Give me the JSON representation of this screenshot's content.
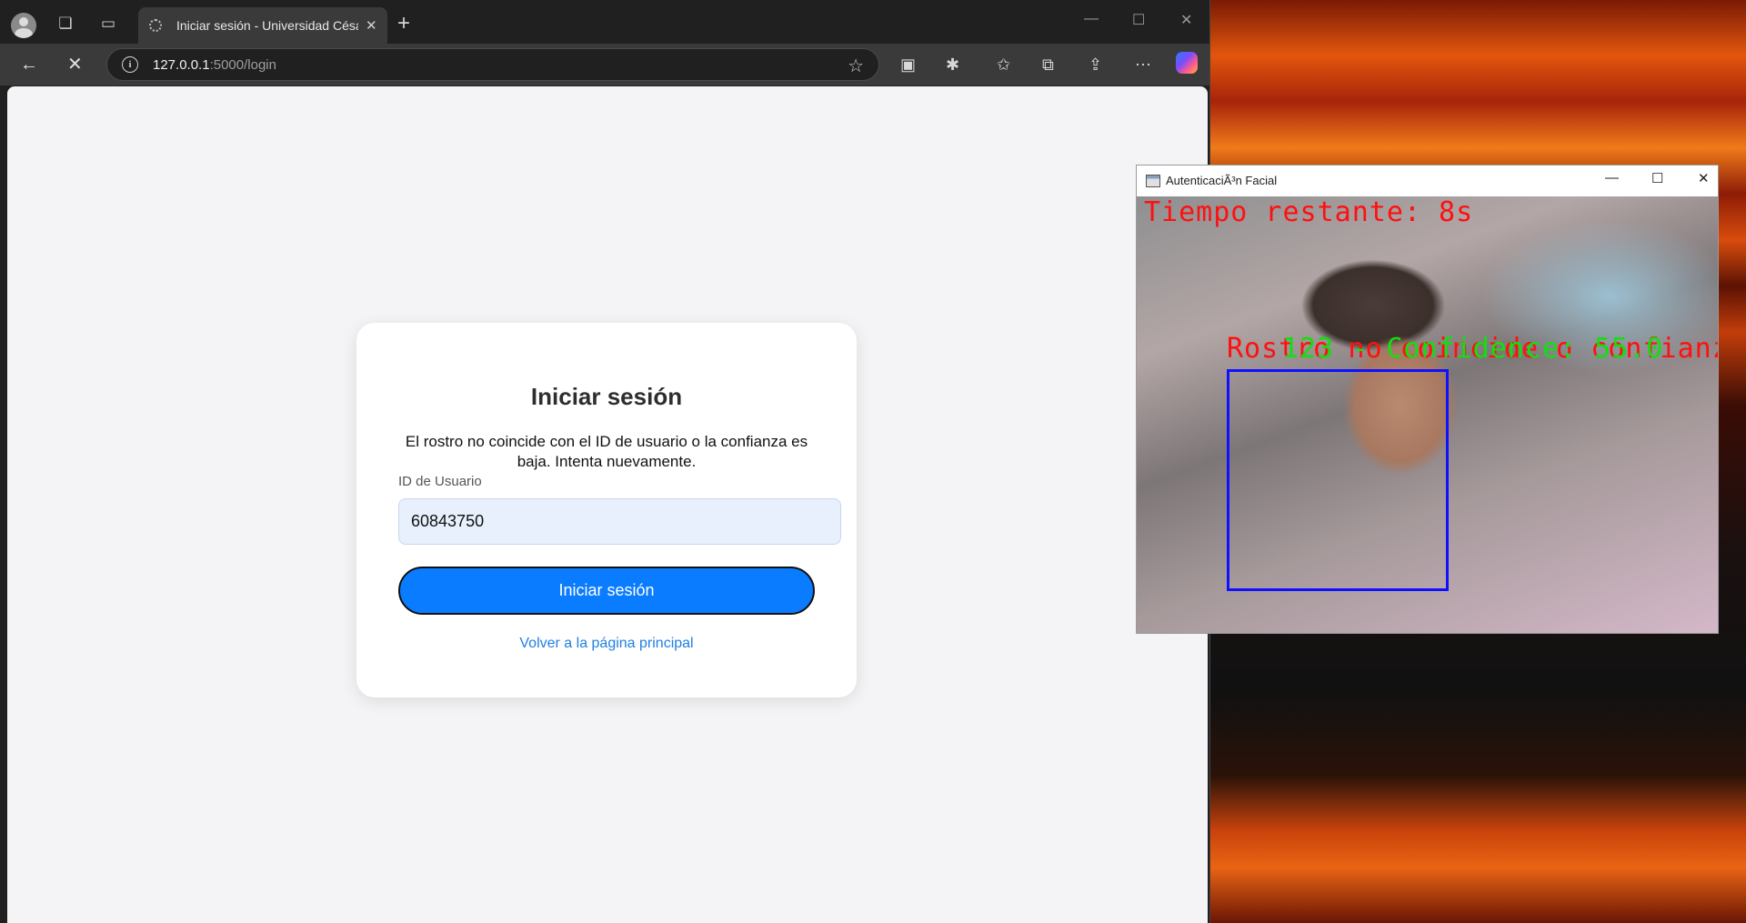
{
  "browser": {
    "tab_title": "Iniciar sesión - Universidad César",
    "new_tab_icon": "+",
    "url_host": "127.0.0.1",
    "url_path": ":5000/login"
  },
  "login": {
    "title": "Iniciar sesión",
    "message": "El rostro no coincide con el ID de usuario o la confianza es baja. Intenta nuevamente.",
    "field_label": "ID de Usuario",
    "field_value": "60843750",
    "submit_label": "Iniciar sesión",
    "back_link": "Volver a la página principal"
  },
  "face_window": {
    "title": "AutenticaciÃ³n Facial",
    "timer_text": "Tiempo restante: 8s",
    "status_text": "Rostro no coincide o confianza baja",
    "match_text": "123 - Confidence: 55.0"
  },
  "colors": {
    "accent": "#0a7cff",
    "link": "#1f7fe0",
    "overlay_red": "#ff1010",
    "overlay_green": "#10e010",
    "face_box": "#1010ff"
  }
}
